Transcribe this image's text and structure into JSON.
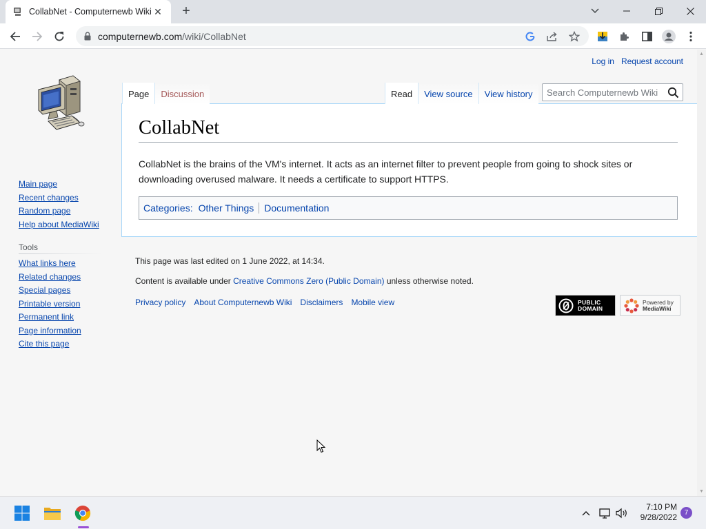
{
  "browser": {
    "tab_title": "CollabNet - Computernewb Wiki",
    "url_host": "computernewb.com",
    "url_path": "/wiki/CollabNet",
    "tab_close_glyph": "✕",
    "new_tab_glyph": "+"
  },
  "personal": {
    "login": "Log in",
    "request_account": "Request account"
  },
  "sidebar": {
    "nav": [
      "Main page",
      "Recent changes",
      "Random page",
      "Help about MediaWiki"
    ],
    "tools_heading": "Tools",
    "tools": [
      "What links here",
      "Related changes",
      "Special pages",
      "Printable version",
      "Permanent link",
      "Page information",
      "Cite this page"
    ]
  },
  "tabs": {
    "page": "Page",
    "discussion": "Discussion",
    "read": "Read",
    "view_source": "View source",
    "view_history": "View history"
  },
  "search": {
    "placeholder": "Search Computernewb Wiki"
  },
  "article": {
    "title": "CollabNet",
    "body": "CollabNet is the brains of the VM's internet. It acts as an internet filter to prevent people from going to shock sites or downloading overused malware. It needs a certificate to support HTTPS.",
    "categories_label": "Categories",
    "categories_colon": ":",
    "categories": [
      "Other Things",
      "Documentation"
    ]
  },
  "footer": {
    "last_edited": "This page was last edited on 1 June 2022, at 14:34.",
    "license_prefix": "Content is available under ",
    "license_link": "Creative Commons Zero (Public Domain)",
    "license_suffix": " unless otherwise noted.",
    "places": [
      "Privacy policy",
      "About Computernewb Wiki",
      "Disclaimers",
      "Mobile view"
    ],
    "badge_pd_line1": "PUBLIC",
    "badge_pd_line2": "DOMAIN",
    "badge_mw_line1": "Powered by",
    "badge_mw_line2": "MediaWiki"
  },
  "taskbar": {
    "time": "7:10 PM",
    "date": "9/28/2022",
    "notification_count": "7"
  },
  "colors": {
    "link": "#0645ad",
    "new_link": "#a55858",
    "content_border": "#a7d7f9",
    "taskbar_accent": "#9b52d6"
  }
}
